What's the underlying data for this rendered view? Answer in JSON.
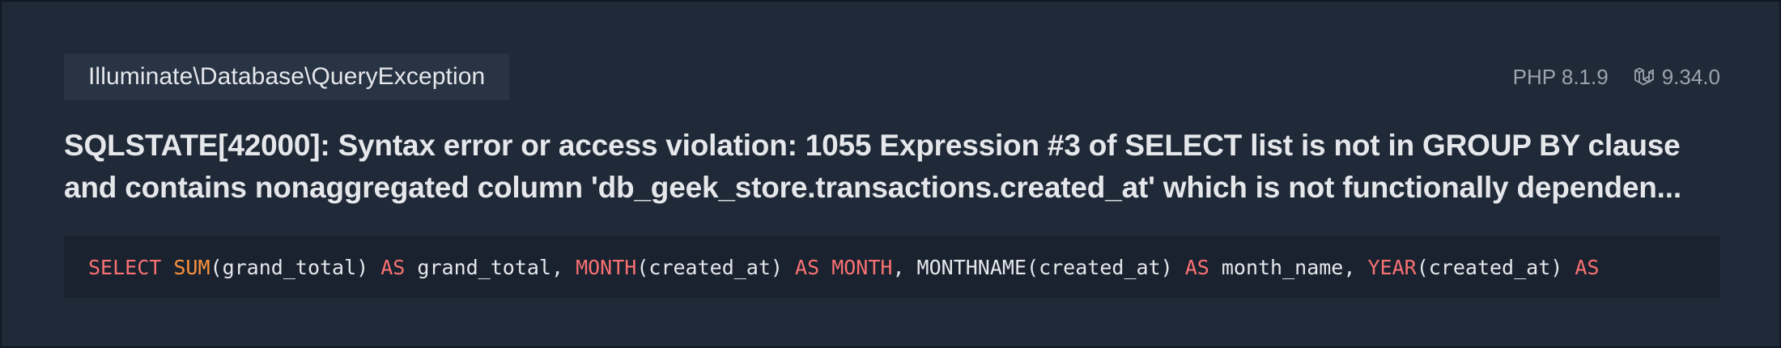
{
  "exception": {
    "class_name": "Illuminate\\Database\\QueryException",
    "php_version": "PHP 8.1.9",
    "framework_version": "9.34.0",
    "framework_icon": "laravel-icon"
  },
  "message": {
    "line1": "SQLSTATE[42000]: Syntax error or access violation: 1055 Expression #3 of SELECT list is not in GROUP BY clause",
    "line2": "and contains nonaggregated column 'db_geek_store.transactions.created_at' which is not functionally dependen..."
  },
  "sql": {
    "tokens": [
      {
        "text": "SELECT",
        "type": "kw"
      },
      {
        "text": " ",
        "type": "plain"
      },
      {
        "text": "SUM",
        "type": "fn"
      },
      {
        "text": "(grand_total) ",
        "type": "plain"
      },
      {
        "text": "AS",
        "type": "kw"
      },
      {
        "text": " grand_total, ",
        "type": "plain"
      },
      {
        "text": "MONTH",
        "type": "kw"
      },
      {
        "text": "(created_at) ",
        "type": "plain"
      },
      {
        "text": "AS",
        "type": "kw"
      },
      {
        "text": " ",
        "type": "plain"
      },
      {
        "text": "MONTH",
        "type": "kw"
      },
      {
        "text": ", MONTHNAME(created_at) ",
        "type": "plain"
      },
      {
        "text": "AS",
        "type": "kw"
      },
      {
        "text": " month_name, ",
        "type": "plain"
      },
      {
        "text": "YEAR",
        "type": "kw"
      },
      {
        "text": "(created_at) ",
        "type": "plain"
      },
      {
        "text": "AS",
        "type": "kw"
      }
    ]
  },
  "colors": {
    "background": "#1f2937",
    "keyword": "#f87171",
    "function": "#fb923c",
    "text": "#e5e7eb",
    "muted": "#9ca3af"
  }
}
